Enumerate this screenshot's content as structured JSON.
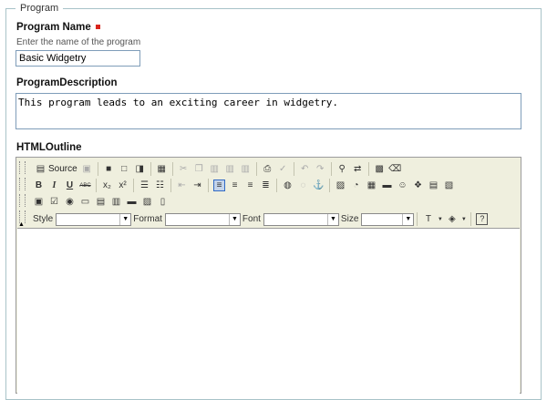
{
  "fieldset": {
    "legend": "Program"
  },
  "program_name": {
    "label": "Program Name",
    "hint": "Enter the name of the program",
    "value": "Basic Widgetry"
  },
  "program_description": {
    "label": "ProgramDescription",
    "value": "This program leads to an exciting career in widgetry."
  },
  "html_outline": {
    "label": "HTMLOutline",
    "toolbar": {
      "source_label": "Source",
      "style_label": "Style",
      "format_label": "Format",
      "font_label": "Font",
      "size_label": "Size",
      "style_value": "",
      "format_value": "",
      "font_value": "",
      "size_value": "",
      "bold_glyph": "B",
      "italic_glyph": "I",
      "underline_glyph": "U",
      "strike_glyph": "ABC",
      "help_glyph": "?"
    },
    "content": ""
  },
  "colors": {
    "fieldset_border": "#a8c3c8",
    "toolbar_bg": "#efefde",
    "required": "#d9251d",
    "active_button": "#c4d4ea"
  }
}
